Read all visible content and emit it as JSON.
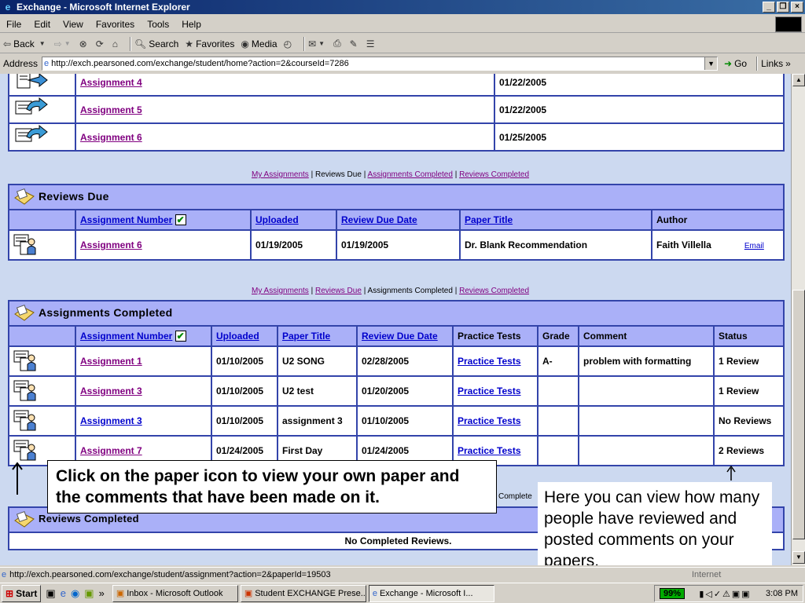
{
  "window": {
    "title": "Exchange - Microsoft Internet Explorer"
  },
  "menu": [
    "File",
    "Edit",
    "View",
    "Favorites",
    "Tools",
    "Help"
  ],
  "toolbar": {
    "back": "Back",
    "search": "Search",
    "favorites": "Favorites",
    "media": "Media"
  },
  "address": {
    "label": "Address",
    "url": "http://exch.pearsoned.com/exchange/student/home?action=2&courseId=7286",
    "go": "Go",
    "links": "Links"
  },
  "my_assignments_top": {
    "rows": [
      {
        "name": "Assignment 4",
        "date": "01/22/2005"
      },
      {
        "name": "Assignment 5",
        "date": "01/22/2005"
      },
      {
        "name": "Assignment 6",
        "date": "01/25/2005"
      }
    ]
  },
  "nav1": {
    "my_assignments": "My Assignments",
    "reviews_due": "Reviews Due",
    "assignments_completed": "Assignments Completed",
    "reviews_completed": "Reviews Completed",
    "sep": "|"
  },
  "reviews_due": {
    "title": "Reviews Due",
    "headers": {
      "assignment_number": "Assignment Number",
      "uploaded": "Uploaded",
      "review_due_date": "Review Due Date",
      "paper_title": "Paper Title",
      "author": "Author"
    },
    "rows": [
      {
        "assignment": "Assignment 6",
        "uploaded": "01/19/2005",
        "due": "01/19/2005",
        "title": "Dr. Blank Recommendation",
        "author": "Faith Villella",
        "email": "Email"
      }
    ]
  },
  "nav2": {
    "my_assignments": "My Assignments",
    "reviews_due": "Reviews Due",
    "assignments_completed": "Assignments Completed",
    "reviews_completed": "Reviews Completed",
    "sep": "|"
  },
  "assignments_completed": {
    "title": "Assignments Completed",
    "headers": {
      "assignment_number": "Assignment Number",
      "uploaded": "Uploaded",
      "paper_title": "Paper Title",
      "review_due_date": "Review Due Date",
      "practice_tests": "Practice Tests",
      "grade": "Grade",
      "comment": "Comment",
      "status": "Status"
    },
    "rows": [
      {
        "assignment": "Assignment 1",
        "uploaded": "01/10/2005",
        "title": "U2 SONG",
        "due": "02/28/2005",
        "practice": "Practice Tests",
        "grade": "A-",
        "comment": "problem with formatting",
        "status": "1 Review"
      },
      {
        "assignment": "Assignment 3",
        "uploaded": "01/10/2005",
        "title": "U2 test",
        "due": "01/20/2005",
        "practice": "Practice Tests",
        "grade": "",
        "comment": "",
        "status": "1 Review"
      },
      {
        "assignment": "Assignment 3",
        "uploaded": "01/10/2005",
        "title": "assignment 3",
        "due": "01/10/2005",
        "practice": "Practice Tests",
        "grade": "",
        "comment": "",
        "status": "No Reviews"
      },
      {
        "assignment": "Assignment 7",
        "uploaded": "01/24/2005",
        "title": "First Day",
        "due": "01/24/2005",
        "practice": "Practice Tests",
        "grade": "",
        "comment": "",
        "status": "2 Reviews"
      }
    ]
  },
  "nav3_partial": "Complete",
  "reviews_completed": {
    "title": "Reviews Completed",
    "empty": "No Completed Reviews."
  },
  "callouts": {
    "paper_icon": "Click on the paper icon to view your own paper and the comments that have been made on it.",
    "reviews_count": "Here you can view how many people have reviewed and posted comments on your papers."
  },
  "statusbar": {
    "url": "http://exch.pearsoned.com/exchange/student/assignment?action=2&paperId=19503",
    "zone": "Internet"
  },
  "taskbar": {
    "start": "Start",
    "tasks": [
      "Inbox - Microsoft Outlook",
      "Student EXCHANGE Prese...",
      "Exchange - Microsoft I..."
    ],
    "battery": "99%",
    "clock": "3:08 PM"
  },
  "colors": {
    "title_bar": "#0a246a",
    "table_header": "#aab0f8",
    "table_border": "#3344aa",
    "page_bg": "#ccd9f0"
  }
}
